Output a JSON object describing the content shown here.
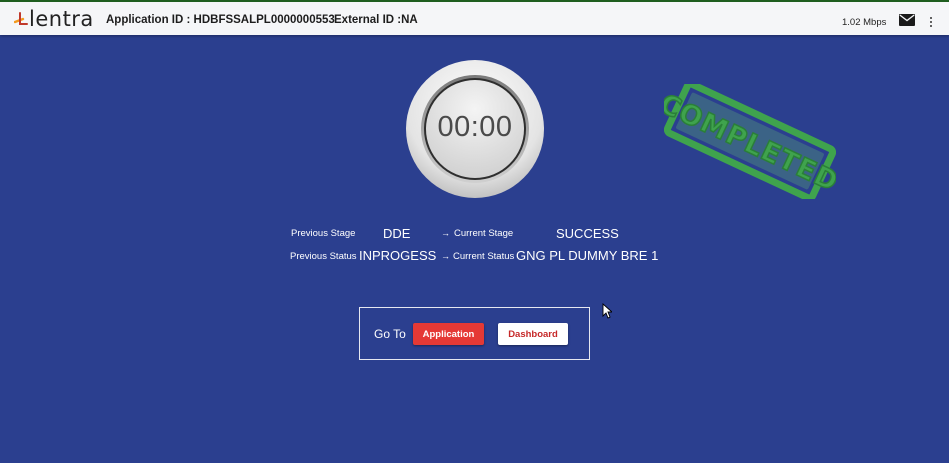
{
  "header": {
    "logo_text": "lentra",
    "application_id": "Application ID : HDBFSSALPL0000000553",
    "external_id": "External ID :NA",
    "speed": "1.02 Mbps",
    "mail_icon": "mail-icon",
    "menu_icon": "kebab-menu-icon"
  },
  "timer": {
    "value": "00:00"
  },
  "stamp": {
    "text": "COMPLETED",
    "color": "#3fa34d"
  },
  "stage": {
    "previous_stage_label": "Previous Stage",
    "previous_stage_value": "DDE",
    "current_stage_label": "Current Stage",
    "current_stage_value": "SUCCESS",
    "previous_status_label": "Previous Status",
    "previous_status_value": "INPROGESS",
    "current_status_label": "Current Status",
    "current_status_value": "GNG PL DUMMY BRE 1",
    "arrow": "→"
  },
  "goto": {
    "label": "Go To",
    "application_button": "Application",
    "dashboard_button": "Dashboard"
  },
  "colors": {
    "background": "#2b3f8f",
    "primary_button": "#e53935",
    "secondary_button_text": "#c62828"
  }
}
